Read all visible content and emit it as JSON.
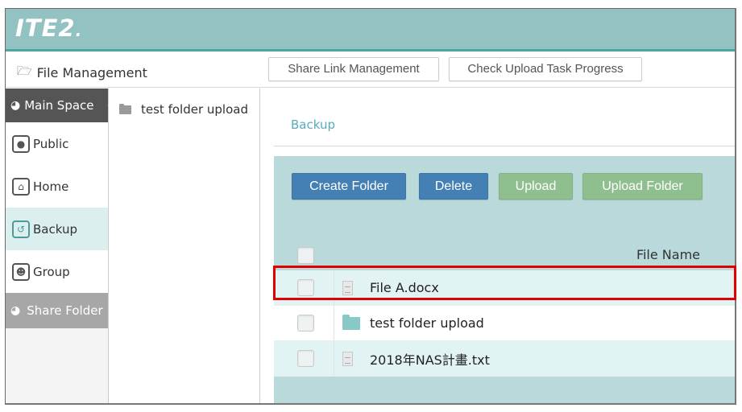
{
  "header": {
    "logo": "ITE2",
    "logo_dot": "."
  },
  "subbar": {
    "title": "File Management",
    "title_icon": "folder-open-icon",
    "buttons": [
      {
        "label": "Share Link Management"
      },
      {
        "label": "Check Upload Task Progress"
      }
    ]
  },
  "sidebar": {
    "header": {
      "label": "Main Space",
      "icon": "pie-chart-icon"
    },
    "items": [
      {
        "label": "Public",
        "icon": "globe-icon",
        "active": false
      },
      {
        "label": "Home",
        "icon": "home-icon",
        "active": false
      },
      {
        "label": "Backup",
        "icon": "history-icon",
        "active": true
      },
      {
        "label": "Group",
        "icon": "users-icon",
        "active": false
      }
    ],
    "share_folder": {
      "label": "Share Folder",
      "icon": "pie-chart-icon"
    }
  },
  "tree": {
    "items": [
      {
        "label": "test folder upload",
        "icon": "folder-icon"
      }
    ]
  },
  "main": {
    "breadcrumb": "Backup",
    "actions": {
      "create_folder": "Create Folder",
      "delete": "Delete",
      "upload": "Upload",
      "upload_folder": "Upload Folder"
    },
    "table": {
      "column_name": "File Name",
      "rows": [
        {
          "name": "File A.docx",
          "type": "file",
          "highlighted": true
        },
        {
          "name": "test folder upload",
          "type": "folder",
          "highlighted": false
        },
        {
          "name": "2018年NAS計畫.txt",
          "type": "file",
          "highlighted": false
        }
      ]
    }
  },
  "colors": {
    "header_bg": "#93c2c2",
    "header_accent": "#4aa8a0",
    "primary_button": "#4580b4",
    "secondary_button": "#8fbe8f",
    "panel_bg": "#bad9db",
    "highlight": "#e00000",
    "breadcrumb": "#5aa9bf"
  }
}
